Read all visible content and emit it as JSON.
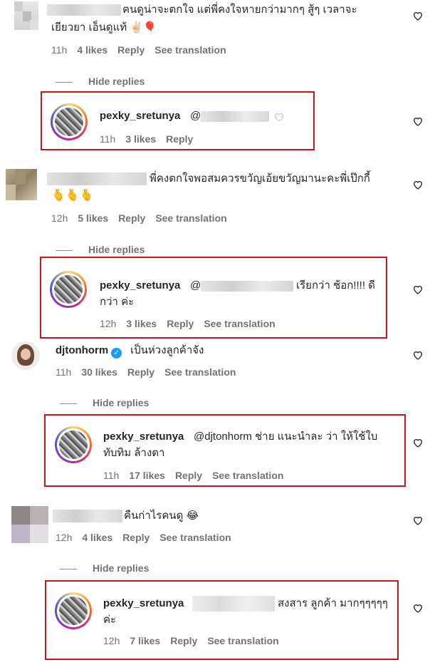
{
  "colors": {
    "highlight": "#c8151b",
    "meta": "#737373",
    "verified": "#1d9bf0"
  },
  "c1": {
    "text_l1": "คนดูน่าจะตกใจ แต่พี่คงใจหายกว่ามากๆ สู้ๆ เวลาจะ",
    "text_l2": "เยียวยา เอ็นดูแท้ ✌🏻🎈",
    "time": "11h",
    "likes": "4 likes",
    "reply": "Reply",
    "translate": "See translation"
  },
  "h1": "Hide replies",
  "r1": {
    "user": "pexky_sretunya",
    "mention": "@",
    "time": "11h",
    "likes": "3 likes",
    "reply": "Reply"
  },
  "c2": {
    "text_l1": "พี่คงตกใจพอสมควรขวัญเอ้ยขวัญมานะคะพี่เป๊กกี้",
    "text_l2": "🫰🫰🫰",
    "time": "12h",
    "likes": "5 likes",
    "reply": "Reply",
    "translate": "See translation"
  },
  "h2": "Hide replies",
  "r2": {
    "user": "pexky_sretunya",
    "mention": "@",
    "text_l1": "เรียกว่า ช้อก!!!! ดี",
    "text_l2": "กว่า ค่ะ",
    "time": "12h",
    "likes": "3 likes",
    "reply": "Reply",
    "translate": "See translation"
  },
  "c3": {
    "user": "djtonhorm",
    "verified": "✓",
    "text": "เป็นห่วงลูกค้าจัง",
    "time": "11h",
    "likes": "30 likes",
    "reply": "Reply",
    "translate": "See translation"
  },
  "h3": "Hide replies",
  "r3": {
    "user": "pexky_sretunya",
    "text_l1": "@djtonhorm ช่าย แนะนำละ ว่า ให้ใช้ใบ",
    "text_l2": "ทับทิม ล้างตา",
    "time": "11h",
    "likes": "17 likes",
    "reply": "Reply",
    "translate": "See translation"
  },
  "c4": {
    "text": "คืนก่าไรคนดู 😂",
    "time": "12h",
    "likes": "4 likes",
    "reply": "Reply",
    "translate": "See translation"
  },
  "h4": "Hide replies",
  "r4": {
    "user": "pexky_sretunya",
    "text_l1": "สงสาร ลูกค้า มากๆๆๆๆๆ",
    "text_l2": "ค่ะ",
    "time": "12h",
    "likes": "7 likes",
    "reply": "Reply",
    "translate": "See translation"
  }
}
